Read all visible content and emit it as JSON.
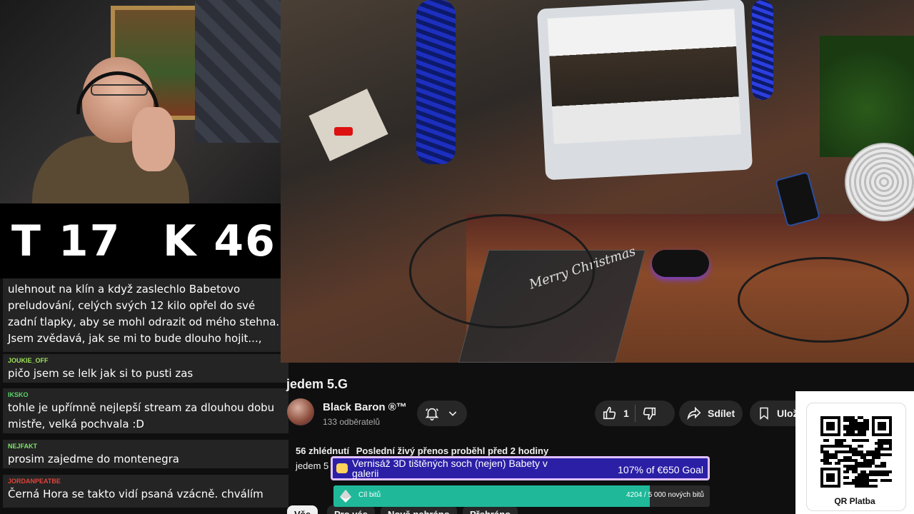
{
  "counters": {
    "t_label": "T 17",
    "k_label": "K 46"
  },
  "chat": {
    "messages": [
      {
        "user": "",
        "user_color": "#ffffff",
        "text": "ulehnout na klín a když zaslechlo Babetovo preludování, celých svých 12 kilo opřel do své zadní tlapky, aby se mohl odrazit od mého stehna. Jsem zvědavá, jak se mi to bude dlouho hojit...,"
      },
      {
        "user": "JOUKIE_OFF",
        "user_color": "#9ee35a",
        "text": "pičo jsem se lelk jak si to pusti zas"
      },
      {
        "user": "IKSKO",
        "user_color": "#5ad66a",
        "text": "tohle je upřímně nejlepší stream za dlouhou dobu mistře, velká pochvala :D"
      },
      {
        "user": "NEJFAKT",
        "user_color": "#7fe36a",
        "text": "prosim zajedme do montenegra"
      },
      {
        "user": "JORDANPEATBE",
        "user_color": "#e0443a",
        "text": "Černá Hora se takto vidí psaná vzácně. chválím"
      }
    ]
  },
  "video": {
    "overlay_text": "Merry Christmas"
  },
  "youtube": {
    "title": "jedem 5.G",
    "channel_name": "Black Baron ®™",
    "subscribers": "133 odběratelů",
    "like_count": "1",
    "share_label": "Sdílet",
    "save_label": "Ulož",
    "views": "56 zhlédnutí",
    "stream_info": "Poslední živý přenos proběhl před 2 hodiny",
    "desc_line": "jedem 5",
    "chips": [
      "Vše",
      "Pro vás",
      "Nově nahráno",
      "Přehráno"
    ]
  },
  "goal": {
    "title": "Vernisáž 3D tištěných soch (nejen) Babety v galerii",
    "amount": "107% of €650 Goal",
    "bits_label": "Cíl bitů",
    "bits_count": "4204 / 5 000 nových bitů",
    "bits_progress": 0.8408,
    "accent": "#1fb99a"
  },
  "qr": {
    "label": "QR Platba"
  }
}
